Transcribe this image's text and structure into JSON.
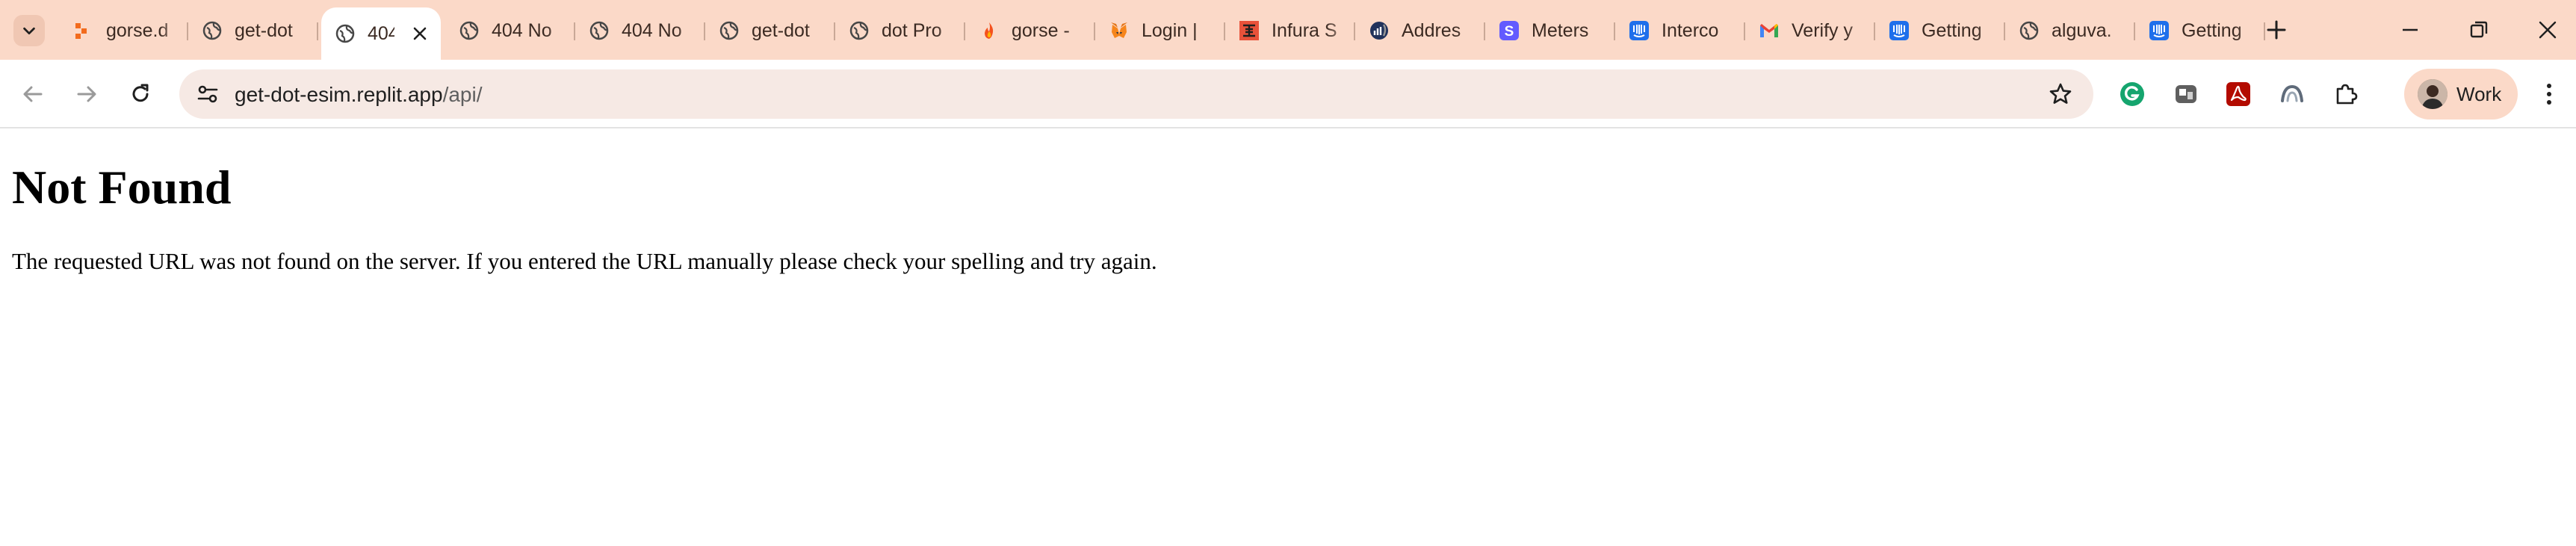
{
  "browser": {
    "tabs": [
      {
        "title": "gorse.d",
        "icon": "gorse-icon",
        "active": false
      },
      {
        "title": "get-dot",
        "icon": "globe-icon",
        "active": false
      },
      {
        "title": "404",
        "icon": "globe-icon",
        "active": true
      },
      {
        "title": "404 No",
        "icon": "globe-icon",
        "active": false
      },
      {
        "title": "404 No",
        "icon": "globe-icon",
        "active": false
      },
      {
        "title": "get-dot",
        "icon": "globe-icon",
        "active": false
      },
      {
        "title": "dot Pro",
        "icon": "globe-icon",
        "active": false
      },
      {
        "title": "gorse -",
        "icon": "flame-icon",
        "active": false
      },
      {
        "title": "Login |",
        "icon": "metamask-icon",
        "active": false
      },
      {
        "title": "Infura S",
        "icon": "infura-icon",
        "active": false
      },
      {
        "title": "Addres",
        "icon": "etherscan-icon",
        "active": false
      },
      {
        "title": "Meters",
        "icon": "stripe-icon",
        "active": false
      },
      {
        "title": "Interco",
        "icon": "intercom-icon",
        "active": false
      },
      {
        "title": "Verify y",
        "icon": "gmail-icon",
        "active": false
      },
      {
        "title": "Getting",
        "icon": "intercom-icon",
        "active": false
      },
      {
        "title": "alguva.",
        "icon": "globe-icon",
        "active": false
      },
      {
        "title": "Getting",
        "icon": "intercom-icon",
        "active": false
      }
    ],
    "url_host": "get-dot-esim.replit.app",
    "url_path": "/api/",
    "profile_label": "Work",
    "colors": {
      "tabstrip": "#fbd9c8",
      "omnibox": "#f6e9e4",
      "grammarly": "#15a56e",
      "acrobat": "#b30b00",
      "stripe": "#635bff",
      "intercom": "#1f6feb",
      "infura": "#e8523a"
    }
  },
  "page": {
    "heading": "Not Found",
    "message": "The requested URL was not found on the server. If you entered the URL manually please check your spelling and try again."
  }
}
